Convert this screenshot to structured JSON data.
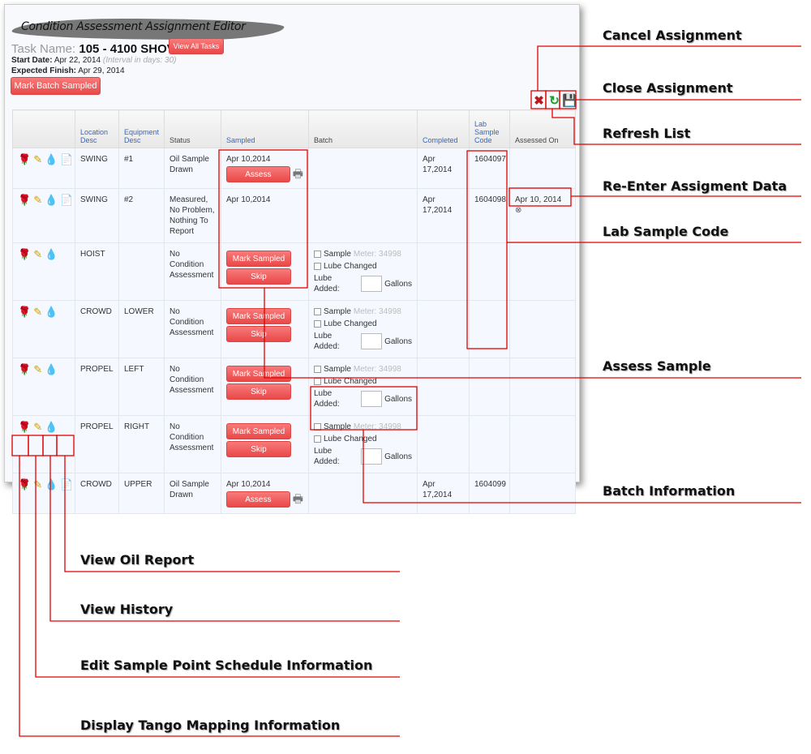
{
  "editor": {
    "title": "Condition Assessment Assignment Editor",
    "task_label": "Task Name:",
    "task_value": "105 - 4100 SHOVEL",
    "view_all_tasks": "View All Tasks",
    "start_label": "Start Date:",
    "start_value": "Apr 22, 2014",
    "interval": "(Interval in days: 30)",
    "finish_label": "Expected Finish:",
    "finish_value": "Apr 29, 2014",
    "mark_batch": "Mark Batch Sampled",
    "toolbar": [
      {
        "icon": "cancel-icon",
        "glyph": "✖",
        "color": "#c0161b"
      },
      {
        "icon": "refresh-icon",
        "glyph": "↻",
        "color": "#1a9a2a"
      },
      {
        "icon": "save-icon",
        "glyph": "💾",
        "color": "#666"
      }
    ]
  },
  "table": {
    "headers": [
      "",
      "Location Desc",
      "Equipment Desc",
      "Status",
      "Sampled",
      "Batch",
      "Completed",
      "Lab Sample Code",
      "Assessed On"
    ],
    "rows": [
      {
        "location": "SWING",
        "equipment": "#1",
        "status": "Oil Sample Drawn",
        "sampled": "Apr 10,2014",
        "action": "Assess",
        "completed": "Apr 17,2014",
        "lab": "1604097",
        "assessed": "",
        "report": true
      },
      {
        "location": "SWING",
        "equipment": "#2",
        "status": "Measured, No Problem, Nothing To Report",
        "sampled": "Apr 10,2014",
        "action": "",
        "completed": "Apr 17,2014",
        "lab": "1604098",
        "assessed": "Apr 10, 2014",
        "report": true
      },
      {
        "location": "HOIST",
        "equipment": "",
        "status": "No Condition Assessment",
        "mark": "Mark Sampled",
        "skip": "Skip",
        "batch": true
      },
      {
        "location": "CROWD",
        "equipment": "LOWER",
        "status": "No Condition Assessment",
        "mark": "Mark Sampled",
        "skip": "Skip",
        "batch": true
      },
      {
        "location": "PROPEL",
        "equipment": "LEFT",
        "status": "No Condition Assessment",
        "mark": "Mark Sampled",
        "skip": "Skip",
        "batch": true
      },
      {
        "location": "PROPEL",
        "equipment": "RIGHT",
        "status": "No Condition Assessment",
        "mark": "Mark Sampled",
        "skip": "Skip",
        "batch": true
      },
      {
        "location": "CROWD",
        "equipment": "UPPER",
        "status": "Oil Sample Drawn",
        "sampled": "Apr 10,2014",
        "action": "Assess",
        "completed": "Apr 17,2014",
        "lab": "1604099",
        "assessed": "",
        "report": true
      }
    ],
    "batch": {
      "sample": "Sample",
      "meter": "Meter: 34998",
      "lube_changed": "Lube Changed",
      "lube_added": "Lube Added:",
      "gallons": "Gallons"
    }
  },
  "annotations": {
    "cancel": "Cancel Assignment",
    "close": "Close Assignment",
    "refresh": "Refresh List",
    "reenter": "Re-Enter Assigment Data",
    "lab": "Lab Sample Code",
    "assess": "Assess Sample",
    "batch": "Batch Information",
    "oil_report": "View Oil Report",
    "history": "View History",
    "edit_schedule": "Edit Sample Point Schedule Information",
    "tango": "Display Tango Mapping Information"
  },
  "colors": {
    "accent": "#e94848",
    "annotation": "#e00000"
  }
}
